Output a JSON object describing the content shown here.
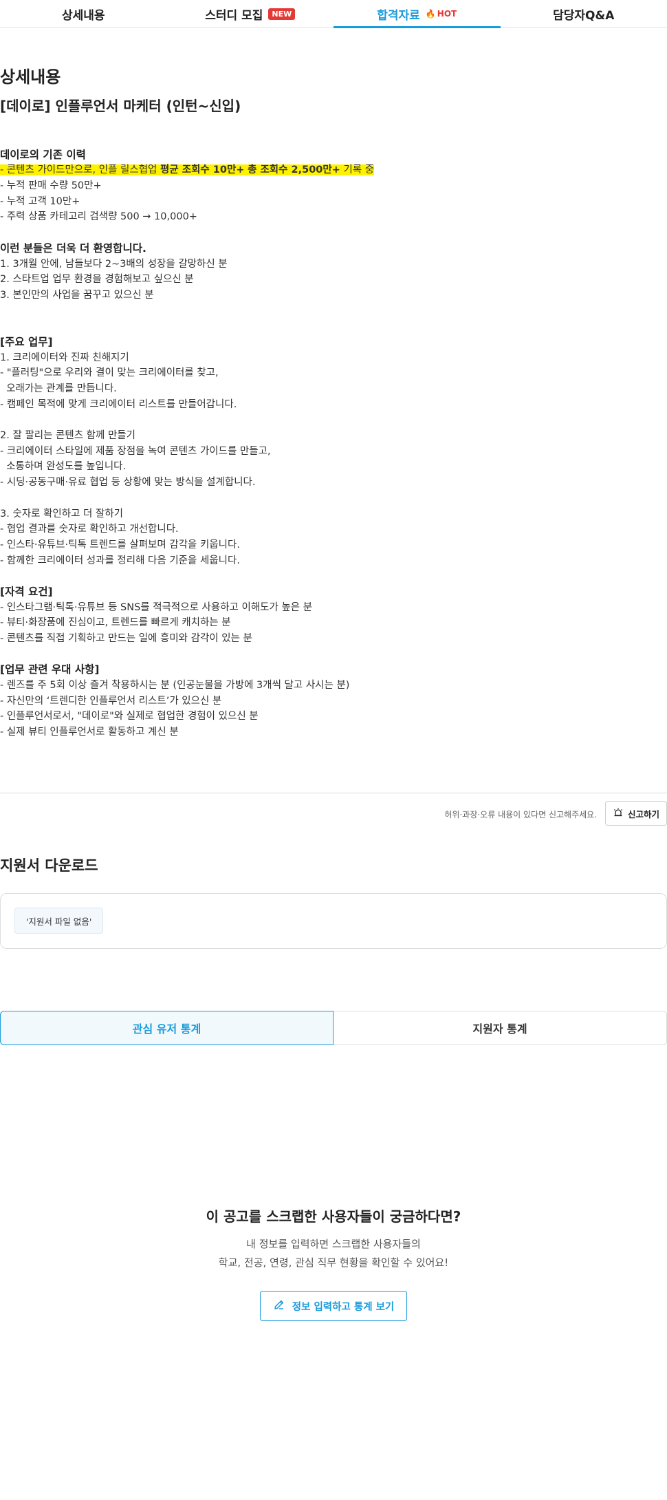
{
  "tabs": [
    {
      "label": "상세내용"
    },
    {
      "label": "스터디 모집",
      "badge": "NEW"
    },
    {
      "label": "합격자료",
      "badge": "HOT"
    },
    {
      "label": "담당자Q&A"
    }
  ],
  "detail": {
    "section_title": "상세내용",
    "job_title": "[데이로] 인플루언서 마케터 (인턴~신입)",
    "lines": [
      {
        "text": ""
      },
      {
        "text": "데이로의 기존 이력",
        "bold": true
      },
      {
        "highlight": true,
        "parts": [
          "- 콘텐츠 가이드만으로, 인플 릴스협업 ",
          "평균 조회수 10만+",
          " ",
          "총 조회수 2,500만+",
          " 기록 중"
        ]
      },
      {
        "text": "- 누적 판매 수량 50만+"
      },
      {
        "text": "- 누적 고객 10만+"
      },
      {
        "text": "- 주력 상품 카테고리 검색량 500 → 10,000+"
      },
      {
        "text": ""
      },
      {
        "text": "이런 분들은 더욱 더 환영합니다.",
        "bold": true
      },
      {
        "text": "1. 3개월 안에, 남들보다 2~3배의 성장을 갈망하신 분"
      },
      {
        "text": "2. 스타트업 업무 환경을 경험해보고 싶으신 분"
      },
      {
        "text": "3. 본인만의 사업을 꿈꾸고 있으신 분"
      },
      {
        "text": ""
      },
      {
        "text": ""
      },
      {
        "text": "[주요 업무]",
        "bold": true
      },
      {
        "text": "1. 크리에이터와 진짜 친해지기"
      },
      {
        "text": "- \"플러팅\"으로 우리와 결이 맞는 크리에이터를 찾고,"
      },
      {
        "text": "  오래가는 관계를 만듭니다."
      },
      {
        "text": "- 캠페인 목적에 맞게 크리에이터 리스트를 만들어갑니다."
      },
      {
        "text": ""
      },
      {
        "text": "2. 잘 팔리는 콘텐츠 함께 만들기"
      },
      {
        "text": "- 크리에이터 스타일에 제품 장점을 녹여 콘텐츠 가이드를 만들고,"
      },
      {
        "text": "  소통하며 완성도를 높입니다."
      },
      {
        "text": "- 시딩·공동구매·유료 협업 등 상황에 맞는 방식을 설계합니다."
      },
      {
        "text": ""
      },
      {
        "text": "3. 숫자로 확인하고 더 잘하기"
      },
      {
        "text": "- 협업 결과를 숫자로 확인하고 개선합니다."
      },
      {
        "text": "- 인스타·유튜브·틱톡 트렌드를 살펴보며 감각을 키웁니다."
      },
      {
        "text": "- 함께한 크리에이터 성과를 정리해 다음 기준을 세웁니다."
      },
      {
        "text": ""
      },
      {
        "text": "[자격 요건]",
        "bold": true
      },
      {
        "text": "- 인스타그램·틱톡·유튜브 등 SNS를 적극적으로 사용하고 이해도가 높은 분"
      },
      {
        "text": "- 뷰티·화장품에 진심이고, 트렌드를 빠르게 캐치하는 분"
      },
      {
        "text": "- 콘텐츠를 직접 기획하고 만드는 일에 흥미와 감각이 있는 분"
      },
      {
        "text": ""
      },
      {
        "text": "[업무 관련 우대 사항]",
        "bold": true
      },
      {
        "text": "- 렌즈를 주 5회 이상 즐겨 착용하시는 분 (인공눈물을 가방에 3개씩 달고 사시는 분)"
      },
      {
        "text": "- 자신만의 ‘트렌디한 인플루언서 리스트’가 있으신 분"
      },
      {
        "text": "- 인플루언서로서, \"데이로\"와 실제로 협업한 경험이 있으신 분"
      },
      {
        "text": "- 실제 뷰티 인플루언서로 활동하고 계신 분"
      }
    ]
  },
  "report": {
    "note": "허위·과장·오류 내용이 있다면 신고해주세요.",
    "button_label": "신고하기",
    "icon": "siren-icon"
  },
  "download": {
    "title": "지원서 다운로드",
    "empty_chip": "'지원서 파일 없음'"
  },
  "stats": {
    "tabs": [
      "관심 유저 통계",
      "지원자 통계"
    ],
    "active_index": 0
  },
  "cta": {
    "title": "이 공고를 스크랩한 사용자들이 궁금하다면?",
    "desc_line1": "내 정보를 입력하면 스크랩한 사용자들의",
    "desc_line2": "학교, 전공, 연령, 관심 직무 현황을 확인할 수 있어요!",
    "button_label": "정보 입력하고 통계 보기",
    "icon": "pencil-icon"
  },
  "colors": {
    "accent": "#1a9bdb",
    "highlight": "#fff200",
    "badge_red": "#e53935"
  }
}
